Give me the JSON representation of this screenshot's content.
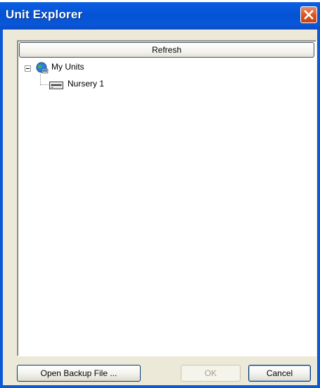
{
  "window": {
    "title": "Unit Explorer"
  },
  "toolbar": {
    "refresh_label": "Refresh"
  },
  "tree": {
    "root": {
      "label": "My Units",
      "icon": "globe-computer-icon",
      "expanded": true
    },
    "children": [
      {
        "label": "Nursery 1",
        "icon": "unit-device-icon"
      }
    ]
  },
  "footer": {
    "open_backup_label": "Open Backup File ...",
    "ok_label": "OK",
    "cancel_label": "Cancel"
  },
  "colors": {
    "titlebar": "#0453d4",
    "close_button": "#d9531c",
    "dialog_face": "#ece9d8",
    "disabled_text": "#a4a195"
  }
}
